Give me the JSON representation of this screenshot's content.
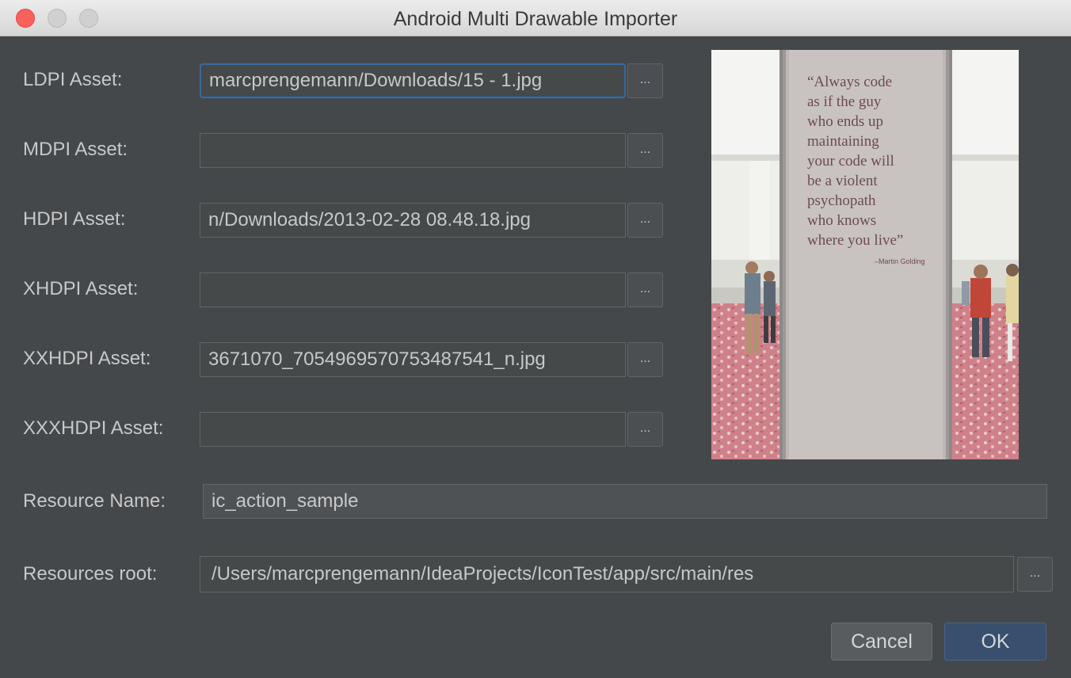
{
  "window": {
    "title": "Android Multi Drawable Importer"
  },
  "assets": [
    {
      "label": "LDPI Asset:",
      "value": "marcprengemann/Downloads/15 - 1.jpg"
    },
    {
      "label": "MDPI Asset:",
      "value": ""
    },
    {
      "label": "HDPI Asset:",
      "value": "n/Downloads/2013-02-28 08.48.18.jpg"
    },
    {
      "label": "XHDPI Asset:",
      "value": ""
    },
    {
      "label": "XXHDPI Asset:",
      "value": "3671070_705496957075348754​1_n.jpg"
    },
    {
      "label": "XXXHDPI Asset:",
      "value": ""
    }
  ],
  "browse_label": "...",
  "resource_name": {
    "label": "Resource Name:",
    "value": "ic_action_sample"
  },
  "resources_root": {
    "label": "Resources root:",
    "value": "/Users/marcprengemann/IdeaProjects/IconTest/app/src/main/res"
  },
  "preview": {
    "quote_lines": [
      "“Always code",
      "as if the guy",
      "who ends up",
      "maintaining",
      "your code will",
      "be a violent",
      "psychopath",
      "who knows",
      "where you live”"
    ],
    "attribution": "–Martin Golding"
  },
  "buttons": {
    "cancel": "Cancel",
    "ok": "OK"
  }
}
